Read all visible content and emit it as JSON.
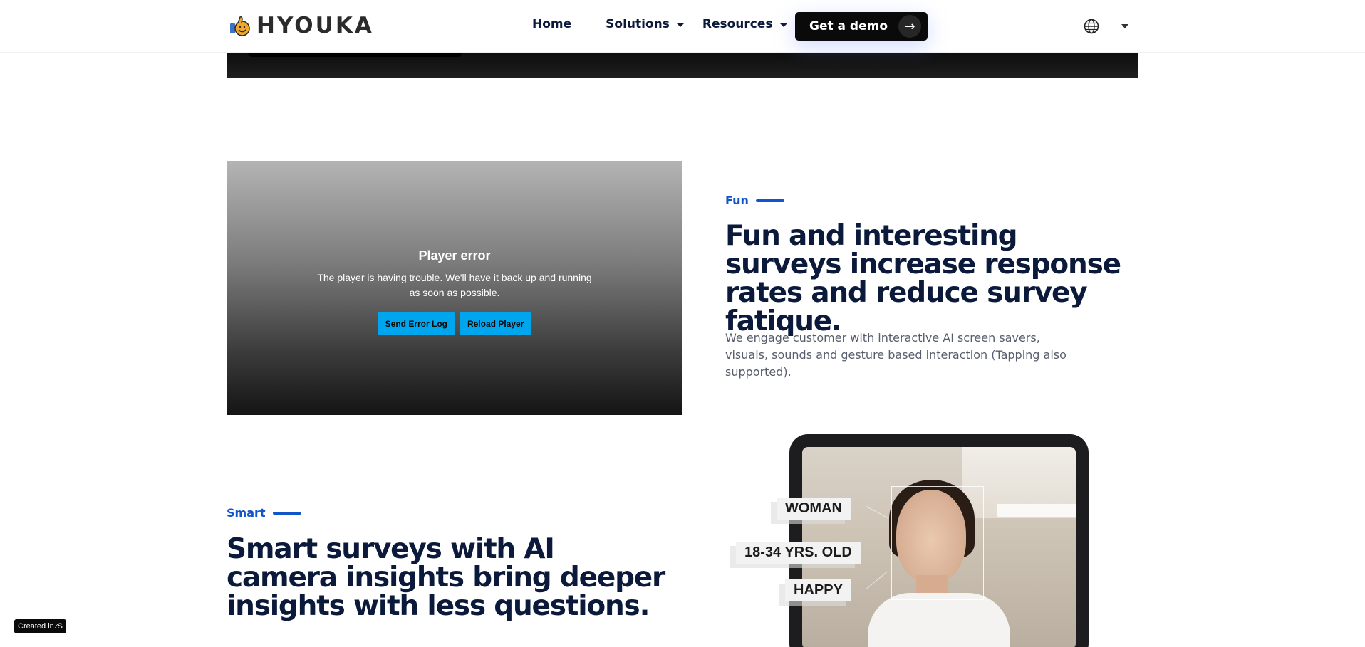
{
  "header": {
    "brand": "HYOUKA",
    "nav": [
      {
        "label": "Home"
      },
      {
        "label": "Solutions"
      },
      {
        "label": "Resources"
      }
    ],
    "cta_label": "Get a demo",
    "cta_arrow": "→"
  },
  "player": {
    "title": "Player error",
    "message": "The player is having trouble. We'll have it back up and running as soon as possible.",
    "buttons": [
      "Send Error Log",
      "Reload Player"
    ]
  },
  "fun": {
    "eyebrow": "Fun",
    "heading": "Fun and interesting surveys increase response rates and reduce survey fatique.",
    "body": "We engage customer with interactive AI screen savers, visuals, sounds and gesture based interaction (Tapping also supported)."
  },
  "smart": {
    "eyebrow": "Smart",
    "heading": "Smart surveys with AI camera insights bring deeper insights with less questions."
  },
  "illustration": {
    "tags": [
      "WOMAN",
      "18-34 YRS. OLD",
      "HAPPY"
    ]
  },
  "badge": "Created in ⁄S",
  "colors": {
    "accent": "#1055c9",
    "heading": "#0b1a3a",
    "player_button": "#00a6ed",
    "cta_bg": "#0a0a0a"
  },
  "icons": [
    "thumbs-up-logo-icon",
    "caret-down-icon",
    "arrow-right-icon",
    "globe-icon"
  ]
}
